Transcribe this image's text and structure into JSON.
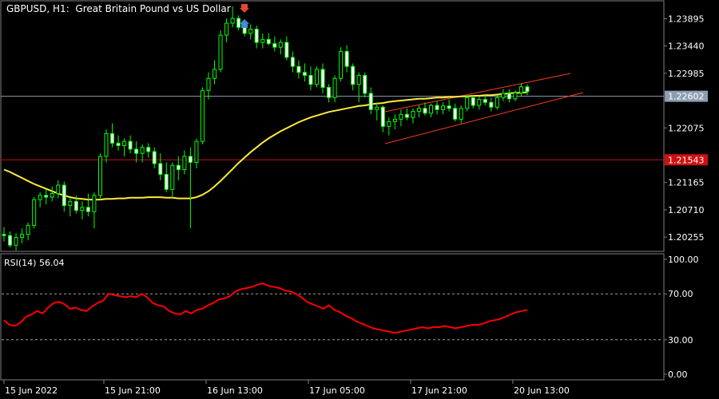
{
  "header": {
    "symbol": "GBPUSD, H1:",
    "description": "Great Britain Pound vs US Dollar"
  },
  "rsi_header": "RSI(14) 56.04",
  "price_axis": {
    "ticks": [
      "1.23895",
      "1.23440",
      "1.22985",
      "1.22075",
      "1.21165",
      "1.20710",
      "1.20255"
    ],
    "tick_values": [
      1.23895,
      1.2344,
      1.22985,
      1.22075,
      1.21165,
      1.2071,
      1.20255
    ],
    "current_price_label": "1.22602",
    "current_price": 1.22602,
    "level_label": "1.21543",
    "level_price": 1.21543
  },
  "rsi_axis": {
    "ticks": [
      "100.00",
      "70.00",
      "30.00",
      "0.00"
    ],
    "tick_values": [
      100,
      70,
      30,
      0
    ]
  },
  "time_axis": {
    "labels": [
      "15 Jun 2022",
      "15 Jun 21:00",
      "16 Jun 13:00",
      "17 Jun 05:00",
      "17 Jun 21:00",
      "20 Jun 13:00"
    ]
  },
  "colors": {
    "background": "#000000",
    "grid": "#808080",
    "bull_candle": "#00ff00",
    "bear_candle": "#ffffff",
    "ma_line": "#ffeb3b",
    "rsi_line": "#ff0000",
    "channel": "#ff3b1f",
    "current_price_line": "#8c9fb0",
    "level_line": "#d01010"
  },
  "chart_data": [
    {
      "type": "candlestick",
      "title": "GBPUSD, H1: Great Britain Pound vs US Dollar",
      "ylim": [
        1.2003,
        1.2418
      ],
      "x_labels": [
        "15 Jun 2022",
        "15 Jun 21:00",
        "16 Jun 13:00",
        "17 Jun 05:00",
        "17 Jun 21:00",
        "20 Jun 13:00"
      ],
      "ohlc": [
        [
          1.203,
          1.2042,
          1.2018,
          1.2028
        ],
        [
          1.2028,
          1.2035,
          1.2008,
          1.2012
        ],
        [
          1.2012,
          1.2032,
          1.2003,
          1.2025
        ],
        [
          1.2025,
          1.204,
          1.2015,
          1.203
        ],
        [
          1.203,
          1.205,
          1.202,
          1.2045
        ],
        [
          1.2045,
          1.2092,
          1.204,
          1.2088
        ],
        [
          1.2088,
          1.21,
          1.2075,
          1.2095
        ],
        [
          1.2095,
          1.2105,
          1.208,
          1.2092
        ],
        [
          1.2092,
          1.211,
          1.2085,
          1.2098
        ],
        [
          1.2098,
          1.212,
          1.209,
          1.2112
        ],
        [
          1.2112,
          1.2118,
          1.2068,
          1.2078
        ],
        [
          1.2078,
          1.209,
          1.206,
          1.2085
        ],
        [
          1.2085,
          1.2095,
          1.2065,
          1.207
        ],
        [
          1.207,
          1.2085,
          1.2055,
          1.2075
        ],
        [
          1.2075,
          1.2098,
          1.206,
          1.2068
        ],
        [
          1.2068,
          1.21,
          1.204,
          1.2095
        ],
        [
          1.2095,
          1.2165,
          1.209,
          1.216
        ],
        [
          1.216,
          1.2205,
          1.215,
          1.2198
        ],
        [
          1.2198,
          1.2215,
          1.2175,
          1.2182
        ],
        [
          1.2182,
          1.2195,
          1.217,
          1.2178
        ],
        [
          1.2178,
          1.219,
          1.216,
          1.2185
        ],
        [
          1.2185,
          1.2195,
          1.2165,
          1.2172
        ],
        [
          1.2172,
          1.2185,
          1.215,
          1.2165
        ],
        [
          1.2165,
          1.218,
          1.215,
          1.2175
        ],
        [
          1.2175,
          1.2182,
          1.2158,
          1.2168
        ],
        [
          1.2168,
          1.2175,
          1.214,
          1.2148
        ],
        [
          1.2148,
          1.2165,
          1.212,
          1.213
        ],
        [
          1.213,
          1.215,
          1.21,
          1.2105
        ],
        [
          1.2105,
          1.215,
          1.209,
          1.2145
        ],
        [
          1.2145,
          1.216,
          1.212,
          1.2138
        ],
        [
          1.2138,
          1.217,
          1.213,
          1.216
        ],
        [
          1.216,
          1.2175,
          1.204,
          1.215
        ],
        [
          1.215,
          1.219,
          1.214,
          1.2185
        ],
        [
          1.2185,
          1.2275,
          1.218,
          1.227
        ],
        [
          1.227,
          1.23,
          1.2255,
          1.229
        ],
        [
          1.229,
          1.232,
          1.228,
          1.2305
        ],
        [
          1.2305,
          1.237,
          1.23,
          1.2362
        ],
        [
          1.2362,
          1.239,
          1.235,
          1.2382
        ],
        [
          1.2382,
          1.241,
          1.2375,
          1.239
        ],
        [
          1.239,
          1.2395,
          1.237,
          1.2375
        ],
        [
          1.2375,
          1.2385,
          1.236,
          1.2365
        ],
        [
          1.2365,
          1.238,
          1.2355,
          1.2372
        ],
        [
          1.2372,
          1.2378,
          1.234,
          1.235
        ],
        [
          1.235,
          1.2365,
          1.234,
          1.2355
        ],
        [
          1.2355,
          1.2365,
          1.2345,
          1.2348
        ],
        [
          1.2348,
          1.236,
          1.2335,
          1.2342
        ],
        [
          1.2342,
          1.2355,
          1.233,
          1.235
        ],
        [
          1.235,
          1.236,
          1.232,
          1.2325
        ],
        [
          1.2325,
          1.2335,
          1.23,
          1.231
        ],
        [
          1.231,
          1.232,
          1.229,
          1.23
        ],
        [
          1.23,
          1.2315,
          1.2285,
          1.2295
        ],
        [
          1.2295,
          1.231,
          1.227,
          1.228
        ],
        [
          1.228,
          1.231,
          1.2275,
          1.2305
        ],
        [
          1.2305,
          1.2315,
          1.2265,
          1.2275
        ],
        [
          1.2275,
          1.228,
          1.225,
          1.2258
        ],
        [
          1.2258,
          1.2295,
          1.225,
          1.229
        ],
        [
          1.229,
          1.2342,
          1.2285,
          1.2335
        ],
        [
          1.2335,
          1.2345,
          1.23,
          1.231
        ],
        [
          1.231,
          1.2315,
          1.227,
          1.228
        ],
        [
          1.228,
          1.23,
          1.225,
          1.2295
        ],
        [
          1.2295,
          1.23,
          1.2258,
          1.2265
        ],
        [
          1.2265,
          1.2275,
          1.223,
          1.2238
        ],
        [
          1.2238,
          1.225,
          1.222,
          1.2242
        ],
        [
          1.2242,
          1.2245,
          1.22,
          1.221
        ],
        [
          1.221,
          1.2225,
          1.2195,
          1.2218
        ],
        [
          1.2218,
          1.223,
          1.2205,
          1.2222
        ],
        [
          1.2222,
          1.2238,
          1.221,
          1.223
        ],
        [
          1.223,
          1.224,
          1.222,
          1.2225
        ],
        [
          1.2225,
          1.224,
          1.2215,
          1.2235
        ],
        [
          1.2235,
          1.2245,
          1.2225,
          1.224
        ],
        [
          1.224,
          1.225,
          1.2228,
          1.2232
        ],
        [
          1.2232,
          1.2248,
          1.2225,
          1.2245
        ],
        [
          1.2245,
          1.2252,
          1.223,
          1.2238
        ],
        [
          1.2238,
          1.225,
          1.223,
          1.2244
        ],
        [
          1.2244,
          1.2255,
          1.2235,
          1.224
        ],
        [
          1.224,
          1.2248,
          1.2218,
          1.2222
        ],
        [
          1.2222,
          1.2245,
          1.2215,
          1.224
        ],
        [
          1.224,
          1.2262,
          1.2235,
          1.2258
        ],
        [
          1.2258,
          1.2262,
          1.224,
          1.2245
        ],
        [
          1.2245,
          1.226,
          1.2238,
          1.2255
        ],
        [
          1.2255,
          1.2262,
          1.2245,
          1.225
        ],
        [
          1.225,
          1.2258,
          1.2235,
          1.2242
        ],
        [
          1.2242,
          1.2262,
          1.2238,
          1.2258
        ],
        [
          1.2258,
          1.2272,
          1.2252,
          1.2265
        ],
        [
          1.2265,
          1.2272,
          1.225,
          1.2256
        ],
        [
          1.2256,
          1.227,
          1.2252,
          1.2266
        ],
        [
          1.2266,
          1.2282,
          1.226,
          1.2276
        ],
        [
          1.2276,
          1.228,
          1.2262,
          1.2268
        ]
      ]
    },
    {
      "type": "line",
      "ylim": [
        0,
        100
      ],
      "series": [
        {
          "name": "RSI(14)",
          "values": [
            47,
            43,
            42,
            45,
            50,
            52,
            55,
            53,
            58,
            62,
            63,
            61,
            57,
            58,
            56,
            55,
            59,
            62,
            64,
            70,
            69,
            68,
            67,
            68,
            67,
            70,
            67,
            62,
            60,
            59,
            55,
            53,
            52,
            55,
            53,
            56,
            57,
            60,
            62,
            65,
            66,
            68,
            72,
            74,
            75,
            76,
            78,
            79,
            77,
            76,
            75,
            73,
            72,
            70,
            67,
            63,
            61,
            59,
            57,
            60,
            56,
            54,
            51,
            49,
            46,
            44,
            42,
            40,
            39,
            38,
            37,
            36,
            37,
            38,
            39,
            40,
            41,
            40,
            41,
            41,
            42,
            41,
            40,
            41,
            42,
            43,
            43,
            44,
            46,
            47,
            48,
            50,
            52,
            54,
            55,
            56
          ]
        }
      ]
    },
    {
      "type": "line",
      "ylim": [
        1.2003,
        1.2418
      ],
      "series": [
        {
          "name": "Moving Average",
          "values": [
            1.2138,
            1.2134,
            1.2129,
            1.2124,
            1.2119,
            1.2114,
            1.211,
            1.2106,
            1.2102,
            1.2098,
            1.2095,
            1.2092,
            1.209,
            1.2089,
            1.2088,
            1.2088,
            1.2088,
            1.2089,
            1.2089,
            1.209,
            1.209,
            1.2091,
            1.2091,
            1.2091,
            1.2092,
            1.2092,
            1.2092,
            1.2091,
            1.2091,
            1.209,
            1.209,
            1.209,
            1.2092,
            1.2096,
            1.2102,
            1.211,
            1.2119,
            1.2129,
            1.2139,
            1.2149,
            1.2158,
            1.2167,
            1.2175,
            1.2183,
            1.219,
            1.2196,
            1.2202,
            1.2207,
            1.2212,
            1.2217,
            1.2221,
            1.2225,
            1.2228,
            1.2231,
            1.2234,
            1.2236,
            1.2238,
            1.224,
            1.2242,
            1.2244,
            1.2245,
            1.2247,
            1.2248,
            1.2249,
            1.2251,
            1.2252,
            1.2253,
            1.2254,
            1.2255,
            1.2256,
            1.2256,
            1.2257,
            1.2258,
            1.2258,
            1.2259,
            1.2259,
            1.226,
            1.226,
            1.2261,
            1.2261,
            1.2262,
            1.2262,
            1.2263,
            1.2264,
            1.2265,
            1.2266,
            1.2266,
            1.2267
          ]
        }
      ]
    }
  ]
}
